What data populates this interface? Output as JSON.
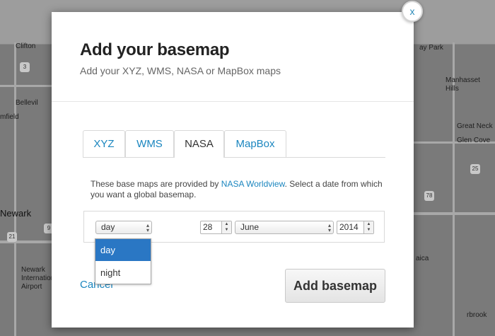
{
  "map": {
    "labels": {
      "clifton": "Clifton",
      "park": "ay Park",
      "mahwah": "Manhasset Hills",
      "woodbury": "Woodbury",
      "glen": "Glen Cove",
      "bellev": "Bellevil",
      "green": "Great Neck",
      "newark": "Newark",
      "field": "mfield",
      "airport": "Newark International Airport",
      "aica": "aica",
      "rbrook": "rbrook"
    },
    "shields": {
      "s1": "3",
      "s2": "21",
      "s3": "9",
      "s4": "78",
      "s5": "25"
    }
  },
  "modal": {
    "close_label": "x",
    "title": "Add your basemap",
    "subtitle": "Add your XYZ, WMS, NASA or MapBox maps",
    "tabs": [
      {
        "label": "XYZ"
      },
      {
        "label": "WMS"
      },
      {
        "label": "NASA"
      },
      {
        "label": "MapBox"
      }
    ],
    "active_tab": "NASA",
    "description_before": "These base maps are provided by ",
    "description_link": "NASA Worldview",
    "description_after": ". Select a date from which you want a global basemap.",
    "mode_select": {
      "value": "day",
      "options": [
        "day",
        "night"
      ],
      "highlighted": "day"
    },
    "day_value": "28",
    "month_select": {
      "value": "June"
    },
    "year_value": "2014",
    "cancel_label": "Cancel",
    "add_button_label": "Add basemap"
  }
}
